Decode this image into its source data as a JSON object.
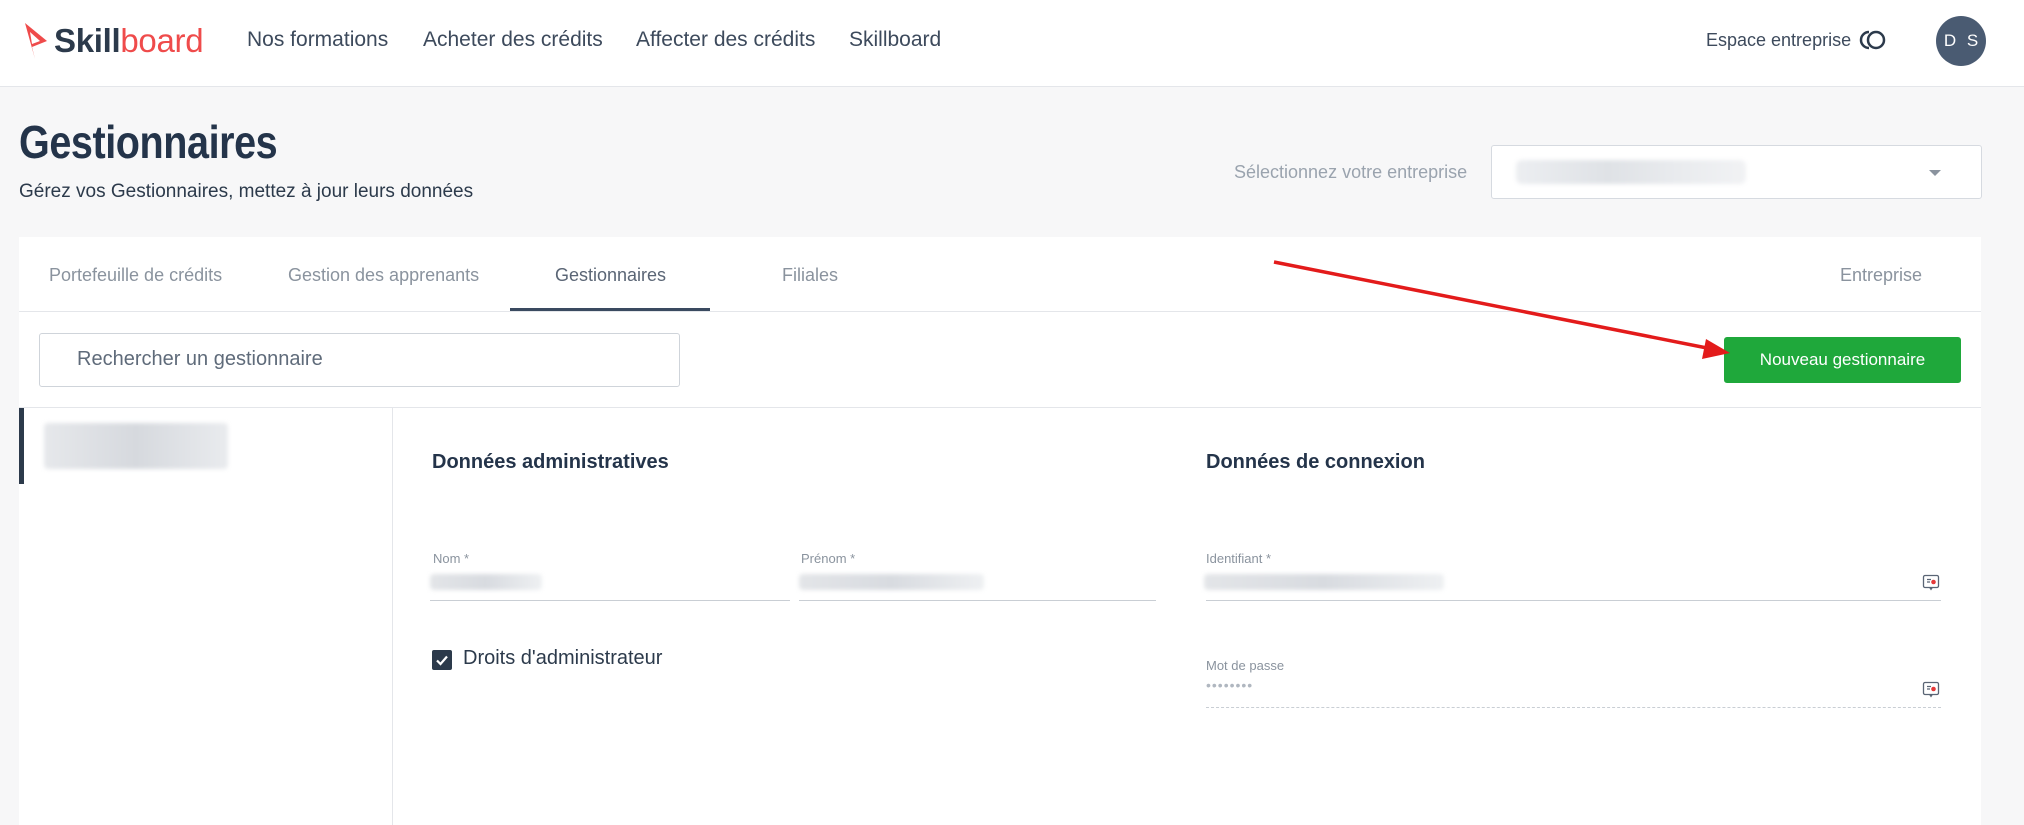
{
  "brand": {
    "name_part1": "Skill",
    "name_part2": "board"
  },
  "nav": {
    "items": [
      "Nos formations",
      "Acheter des crédits",
      "Affecter des crédits",
      "Skillboard"
    ],
    "espace_label": "Espace entreprise",
    "avatar_initials": "D S"
  },
  "header": {
    "title": "Gestionnaires",
    "subtitle": "Gérez vos Gestionnaires, mettez à jour leurs données",
    "select_label": "Sélectionnez votre entreprise",
    "select_value": ""
  },
  "tabs": {
    "items": [
      "Portefeuille de crédits",
      "Gestion des apprenants",
      "Gestionnaires",
      "Filiales",
      "Entreprise"
    ],
    "active": "Gestionnaires"
  },
  "search": {
    "placeholder": "Rechercher un gestionnaire"
  },
  "actions": {
    "new_manager": "Nouveau gestionnaire"
  },
  "form": {
    "admin_title": "Données administratives",
    "login_title": "Données de connexion",
    "nom_label": "Nom *",
    "prenom_label": "Prénom *",
    "identifiant_label": "Identifiant *",
    "password_label": "Mot de passe",
    "password_value": "••••••••",
    "admin_rights_label": "Droits d'administrateur",
    "admin_rights_checked": true
  },
  "colors": {
    "primary_dark": "#2c3a4b",
    "accent_red": "#ef4b4b",
    "button_green": "#1fa83b",
    "annotation_arrow": "#e31b1b"
  }
}
